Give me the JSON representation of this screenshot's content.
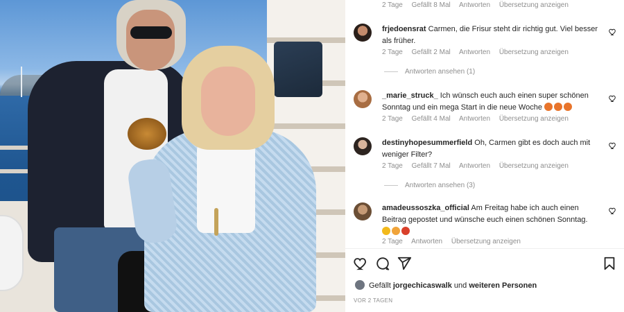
{
  "post_image": {
    "alt_icon": "photo"
  },
  "comments": [
    {
      "meta": {
        "time": "2 Tage",
        "likes": "Gefällt 8 Mal",
        "reply": "Antworten",
        "translate": "Übersetzung anzeigen"
      }
    },
    {
      "username": "frjedoensrat",
      "text": "Carmen, die Frisur steht dir richtig gut. Viel besser als früher.",
      "meta": {
        "time": "2 Tage",
        "likes": "Gefällt 2 Mal",
        "reply": "Antworten",
        "translate": "Übersetzung anzeigen"
      },
      "view_replies": "Antworten ansehen (1)"
    },
    {
      "username": "_marie_struck_",
      "text": "Ich wünsch euch auch einen super schönen Sonntag und ein mega Start in die neue Woche",
      "emojis": [
        "#e8742b",
        "#e8742b",
        "#e8742b"
      ],
      "meta": {
        "time": "2 Tage",
        "likes": "Gefällt 4 Mal",
        "reply": "Antworten",
        "translate": "Übersetzung anzeigen"
      }
    },
    {
      "username": "destinyhopesummerfield",
      "text": "Oh, Carmen gibt es doch auch mit weniger Filter?",
      "meta": {
        "time": "2 Tage",
        "likes": "Gefällt 7 Mal",
        "reply": "Antworten",
        "translate": "Übersetzung anzeigen"
      },
      "view_replies": "Antworten ansehen (3)"
    },
    {
      "username": "amadeussoszka_official",
      "text": "Am Freitag habe ich auch einen Beitrag gepostet und wünsche euch einen schönen Sonntag.",
      "emojis": [
        "#f2b91c",
        "#f0a43a",
        "#d9402b"
      ],
      "meta": {
        "time": "2 Tage",
        "reply": "Antworten",
        "translate": "Übersetzung anzeigen"
      }
    }
  ],
  "actions": {
    "like_icon": "heart-icon",
    "comment_icon": "comment-icon",
    "share_icon": "share-icon",
    "save_icon": "bookmark-icon"
  },
  "likes_line": {
    "prefix": "Gefällt",
    "user": "jorgechicaswalk",
    "connector": "und",
    "others": "weiteren Personen"
  },
  "date": "VOR 2 TAGEN",
  "colors": {
    "text": "#262626",
    "secondary": "#8e8e8e",
    "divider": "#efefef"
  }
}
